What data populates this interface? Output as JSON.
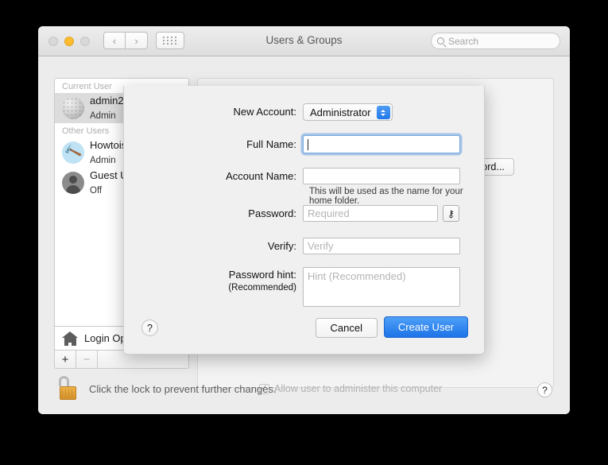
{
  "window": {
    "title": "Users & Groups",
    "traffic_lights": [
      "close",
      "minimize",
      "zoom"
    ],
    "nav_back_icon": "chevron-left-icon",
    "nav_forward_icon": "chevron-right-icon",
    "grid_icon": "show-all-preferences-icon"
  },
  "search": {
    "placeholder": "Search",
    "value": "",
    "icon": "search-icon"
  },
  "sidebar": {
    "groups": [
      {
        "header": "Current User",
        "users": [
          {
            "name": "admin2",
            "role": "Admin",
            "avatar": "golfball-avatar",
            "selected": true
          }
        ]
      },
      {
        "header": "Other Users",
        "users": [
          {
            "name": "Howtois",
            "role": "Admin",
            "avatar": "hammer-avatar",
            "selected": false
          },
          {
            "name": "Guest U",
            "role": "Off",
            "avatar": "guest-person-avatar",
            "selected": false
          }
        ]
      }
    ],
    "login_options": "Login Options",
    "login_options_icon": "house-icon",
    "add_label": "+",
    "remove_label": "−"
  },
  "right_pane": {
    "change_password_label": "sword...",
    "admin_checkbox": {
      "label": "Allow user to administer this computer",
      "checked": true,
      "check_glyph": "✓",
      "enabled": false
    }
  },
  "footer": {
    "lock_icon": "unlocked-padlock-icon",
    "lock_text": "Click the lock to prevent further changes.",
    "help_label": "?"
  },
  "sheet": {
    "new_account": {
      "label": "New Account:",
      "value": "Administrator",
      "chevron_icon": "chevron-updown-icon"
    },
    "full_name": {
      "label": "Full Name:",
      "value": "",
      "placeholder": "",
      "focused": true
    },
    "account_name": {
      "label": "Account Name:",
      "value": "",
      "placeholder": "",
      "help_text": "This will be used as the name for your home folder."
    },
    "password": {
      "label": "Password:",
      "value": "",
      "placeholder": "Required",
      "key_button_icon": "key-icon",
      "key_glyph": "⚷"
    },
    "verify": {
      "label": "Verify:",
      "value": "",
      "placeholder": "Verify"
    },
    "hint": {
      "label": "Password hint:",
      "sublabel": "(Recommended)",
      "value": "",
      "placeholder": "Hint (Recommended)"
    },
    "help_label": "?",
    "cancel_label": "Cancel",
    "create_label": "Create User"
  },
  "colors": {
    "accent_blue": "#1e73e8",
    "minimize_yellow": "#febc2e",
    "lock_gold": "#d4902a",
    "window_bg": "#ececec",
    "sheet_bg": "#f0f0f0"
  }
}
